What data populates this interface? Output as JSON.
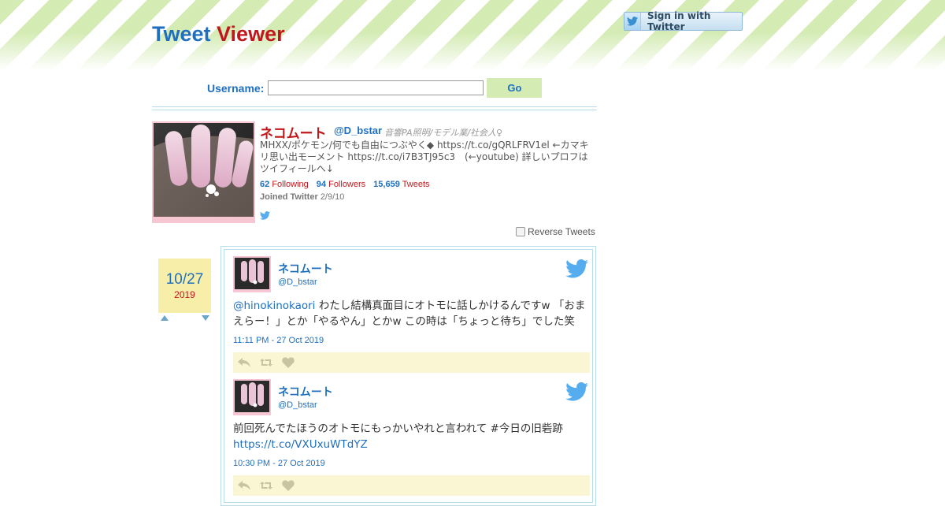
{
  "site": {
    "title_part1": "Tweet",
    "title_part2": "Viewer"
  },
  "signin": {
    "label": "Sign in with Twitter"
  },
  "search": {
    "label": "Username:",
    "value": "",
    "placeholder": "",
    "button": "Go"
  },
  "profile": {
    "name": "ネコムート",
    "handle": "@D_bstar",
    "tagline": "音響PA照明/モデル業/社会人♀",
    "bio": "MHXX/ポケモン/何でも自由につぶやく◆ https://t.co/gQRLFRV1el ←カマキリ思い出モーメント https://t.co/i7B3TJ95c3　(←youtube) 詳しいプロフはツイフィールへ↓",
    "following_count": "62",
    "following_label": "Following",
    "followers_count": "94",
    "followers_label": "Followers",
    "tweets_count": "15,659",
    "tweets_label": "Tweets",
    "joined_label": "Joined Twitter",
    "joined_date": "2/9/10"
  },
  "reverse": {
    "label": "Reverse Tweets"
  },
  "date_nav": {
    "month_day": "10/27",
    "year": "2019"
  },
  "tweets": [
    {
      "name": "ネコムート",
      "handle": "@D_bstar",
      "mention": "@hinokinokaori",
      "text": " わたし結構真面目にオトモに話しかけるんですw 「おまえらー！」とか「やるやん」とかw この時は「ちょっと待ち」でした笑",
      "link": "",
      "time": "11:11 PM - 27 Oct 2019"
    },
    {
      "name": "ネコムート",
      "handle": "@D_bstar",
      "mention": "",
      "text": "前回死んでたほうのオトモにもっかいやれと言われて #今日の旧砦跡",
      "link": "https://t.co/VXUxuWTdYZ",
      "time": "10:30 PM - 27 Oct 2019"
    }
  ],
  "colors": {
    "blue": "#1f6fbf",
    "red": "#c0171c",
    "green": "#d4ebb4",
    "yellow": "#f7eea9",
    "action_bar": "#faf6d4",
    "twitter": "#55acee"
  },
  "icons": {
    "twitter": "twitter-bird-icon",
    "reply": "reply-icon",
    "retweet": "retweet-icon",
    "like": "heart-icon",
    "prev": "triangle-up-icon",
    "next": "triangle-down-icon"
  }
}
